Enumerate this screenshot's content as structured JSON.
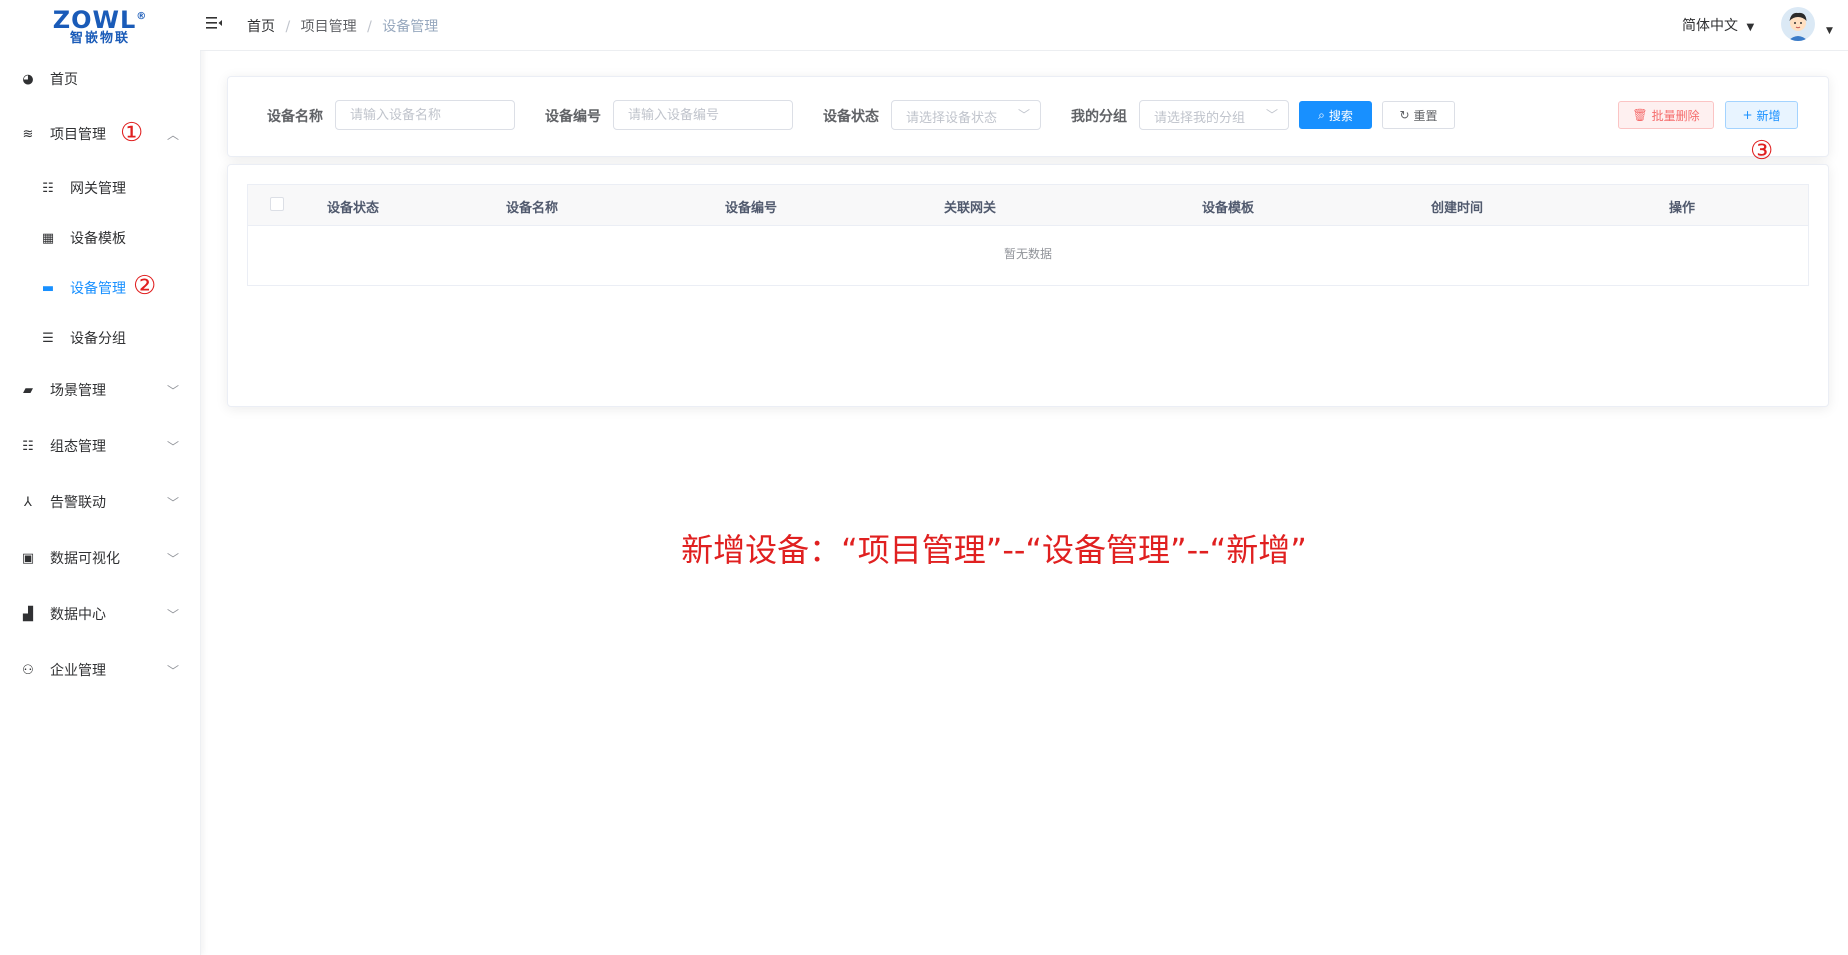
{
  "logo": {
    "main": "ZOWL",
    "reg": "®",
    "sub": "智嵌物联"
  },
  "header": {
    "breadcrumb": [
      "首页",
      "项目管理",
      "设备管理"
    ],
    "separator": "/",
    "language": "简体中文"
  },
  "sidebar": {
    "items": [
      {
        "label": "首页",
        "icon": "dashboard-icon"
      },
      {
        "label": "项目管理",
        "icon": "layers-icon",
        "expanded": true,
        "marker": "①"
      },
      {
        "label": "网关管理",
        "icon": "tree-table-icon"
      },
      {
        "label": "设备模板",
        "icon": "grid-icon"
      },
      {
        "label": "设备管理",
        "icon": "server-icon",
        "active": true,
        "marker": "②"
      },
      {
        "label": "设备分组",
        "icon": "tree-icon"
      },
      {
        "label": "场景管理",
        "icon": "clapper-icon"
      },
      {
        "label": "组态管理",
        "icon": "tree-table-icon"
      },
      {
        "label": "告警联动",
        "icon": "network-icon"
      },
      {
        "label": "数据可视化",
        "icon": "monitor-icon"
      },
      {
        "label": "数据中心",
        "icon": "bar-chart-icon"
      },
      {
        "label": "企业管理",
        "icon": "user-settings-icon"
      }
    ]
  },
  "search": {
    "name_label": "设备名称",
    "name_placeholder": "请输入设备名称",
    "code_label": "设备编号",
    "code_placeholder": "请输入设备编号",
    "status_label": "设备状态",
    "status_placeholder": "请选择设备状态",
    "group_label": "我的分组",
    "group_placeholder": "请选择我的分组",
    "search_btn": "搜索",
    "reset_btn": "重置",
    "batch_delete_btn": "批量删除",
    "add_btn": "新增",
    "add_marker": "③"
  },
  "table": {
    "columns": [
      "设备状态",
      "设备名称",
      "设备编号",
      "关联网关",
      "设备模板",
      "创建时间",
      "操作"
    ],
    "empty_text": "暂无数据"
  },
  "annotation": "新增设备：“项目管理”--“设备管理”--“新增”",
  "colors": {
    "primary": "#1890ff",
    "danger": "#f56c6c",
    "annotation": "#e02020",
    "brand": "#1a5bb8"
  }
}
